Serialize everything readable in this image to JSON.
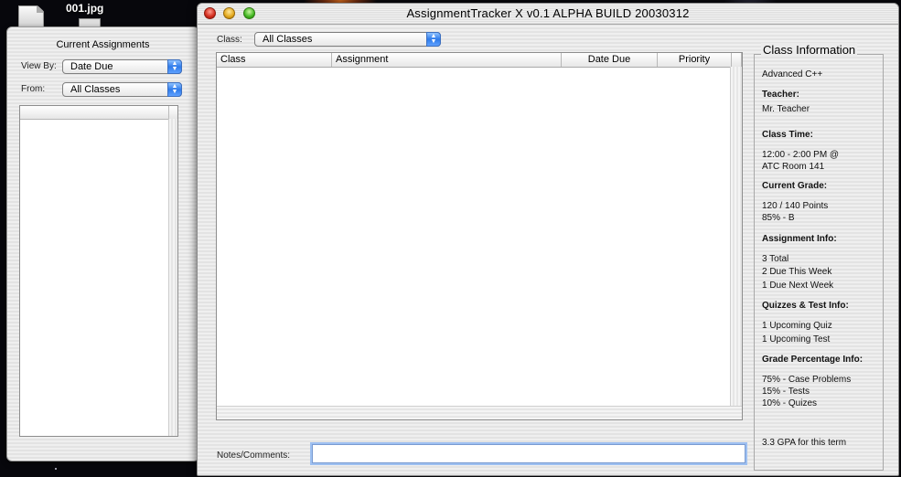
{
  "desktop": {
    "icon_label": "001.jpg"
  },
  "drawer": {
    "title": "Current Assignments",
    "view_by_label": "View By:",
    "view_by_value": "Date Due",
    "from_label": "From:",
    "from_value": "All Classes"
  },
  "window": {
    "title": "AssignmentTracker X v0.1 ALPHA BUILD 20030312",
    "class_label": "Class:",
    "class_value": "All Classes",
    "columns": [
      "Class",
      "Assignment",
      "Date Due",
      "Priority"
    ],
    "rows": [],
    "notes_label": "Notes/Comments:",
    "notes_value": ""
  },
  "class_info": {
    "heading": "Class Information",
    "class_name": "Advanced C++",
    "teacher_label": "Teacher:",
    "teacher": "Mr. Teacher",
    "class_time_label": "Class Time:",
    "class_time_line1": "12:00 - 2:00 PM @",
    "class_time_line2": "ATC Room 141",
    "grade_label": "Current Grade:",
    "grade_points": "120 / 140 Points",
    "grade_percent": "85% - B",
    "assignment_info_label": "Assignment Info:",
    "assignment_total": "3 Total",
    "assignment_this_week": "2 Due This Week",
    "assignment_next_week": "1 Due Next Week",
    "quiz_test_label": "Quizzes & Test Info:",
    "upcoming_quiz": "1 Upcoming Quiz",
    "upcoming_test": "1 Upcoming Test",
    "grade_pct_label": "Grade Percentage Info:",
    "pct_case": "75% - Case Problems",
    "pct_tests": "15% - Tests",
    "pct_quizes": "10% - Quizes",
    "gpa": "3.3 GPA for this term"
  },
  "colors": {
    "accent_blue": "#2f7bea",
    "focus_ring": "#9ec0f1",
    "close": "#d12b1c",
    "minimize": "#e2a71c",
    "zoom": "#41b621"
  }
}
